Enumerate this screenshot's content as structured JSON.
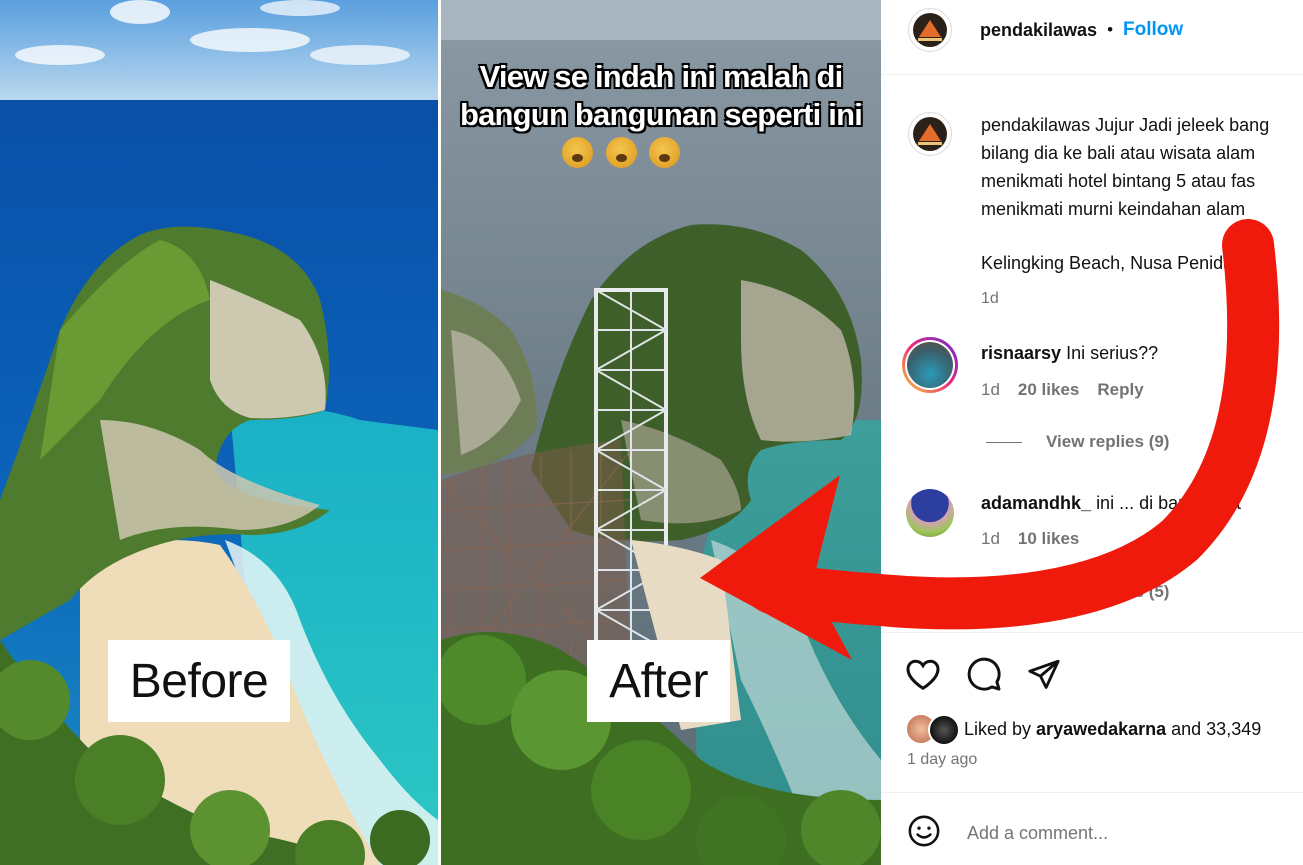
{
  "media": {
    "before_label": "Before",
    "after_label": "After",
    "overlay_text_line1": "View se indah ini malah di",
    "overlay_text_line2": "bangun bangunan seperti ini",
    "emoji_name": "crying-face-emoji"
  },
  "header": {
    "username": "pendakilawas",
    "separator": "•",
    "follow_label": "Follow"
  },
  "caption": {
    "username": "pendakilawas",
    "lines": [
      "Jujur Jadi jeleek bang",
      "bilang dia ke bali atau wisata alam",
      "menikmati hotel bintang 5 atau fas",
      "menikmati murni keindahan alam"
    ],
    "location": "Kelingking Beach, Nusa Penida, Bali",
    "time": "1d"
  },
  "comments": [
    {
      "username": "risnaarsy",
      "text": "Ini serius??",
      "time": "1d",
      "likes": "20 likes",
      "reply_label": "Reply",
      "view_replies": "View replies (9)"
    },
    {
      "username": "adamandhk_",
      "text": "ini ... di bangun lift",
      "time": "1d",
      "likes": "10 likes",
      "view_replies": "View replies (5)"
    }
  ],
  "actions": {
    "liked_by_prefix": "Liked by",
    "liked_by_user": "aryawedakarna",
    "liked_by_suffix": "and 33,349",
    "timestamp": "1 day ago",
    "comment_placeholder": "Add a comment..."
  },
  "colors": {
    "accent": "#0095f6",
    "arrow": "#f01a0c",
    "muted": "#737373"
  }
}
